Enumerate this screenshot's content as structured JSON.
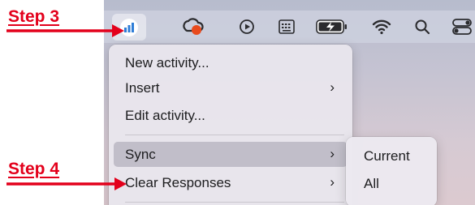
{
  "annotations": {
    "step3_label": "Step 3",
    "step4_label": "Step 4",
    "arrow_color": "#e3001b"
  },
  "menubar": {
    "icons": [
      "app-chart-icon",
      "creative-cloud-icon",
      "play-circle-icon",
      "keyboard-icon",
      "battery-charging-icon",
      "wifi-icon",
      "search-icon",
      "control-center-icon"
    ],
    "recording_dot_color": "#e84a1d"
  },
  "menu": {
    "items": [
      {
        "label": "New activity..."
      },
      {
        "label": "Insert",
        "submenu": true
      },
      {
        "label": "Edit activity..."
      },
      {
        "label": "Sync",
        "submenu": true,
        "highlighted": true
      },
      {
        "label": "Clear Responses",
        "submenu": true
      }
    ],
    "chevron": "›"
  },
  "submenu": {
    "items": [
      "Current",
      "All"
    ]
  }
}
